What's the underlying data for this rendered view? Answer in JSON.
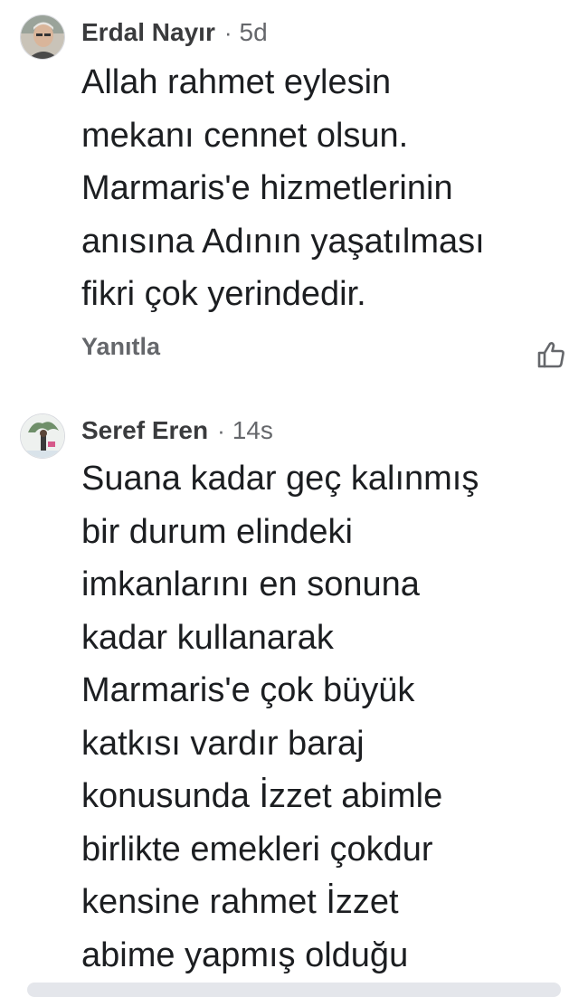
{
  "comments": [
    {
      "author": "Erdal Nayır",
      "separator": "·",
      "time": "5d",
      "text": "Allah rahmet eylesin\nmekanı cennet olsun.\nMarmaris'e hizmetlerinin\nanısına Adının yaşatılması\nfikri çok yerindedir.",
      "reply_label": "Yanıtla",
      "like_icon": "thumbs-up-outline-icon"
    },
    {
      "author": "Seref Eren",
      "separator": "·",
      "time": "14s",
      "text": "Suana kadar geç kalınmış\nbir durum elindeki\nimkanlarını en sonuna\nkadar kullanarak\nMarmaris'e çok büyük\nkatkısı vardır baraj\nkonusunda İzzet abimle\nbirlikte emekleri çokdur\nkensine rahmet İzzet\nabime yapmış olduğu"
    }
  ],
  "colors": {
    "author": "#3a3b3d",
    "meta": "#65676b",
    "text": "#1c1e21",
    "bar": "#e4e6eb"
  }
}
